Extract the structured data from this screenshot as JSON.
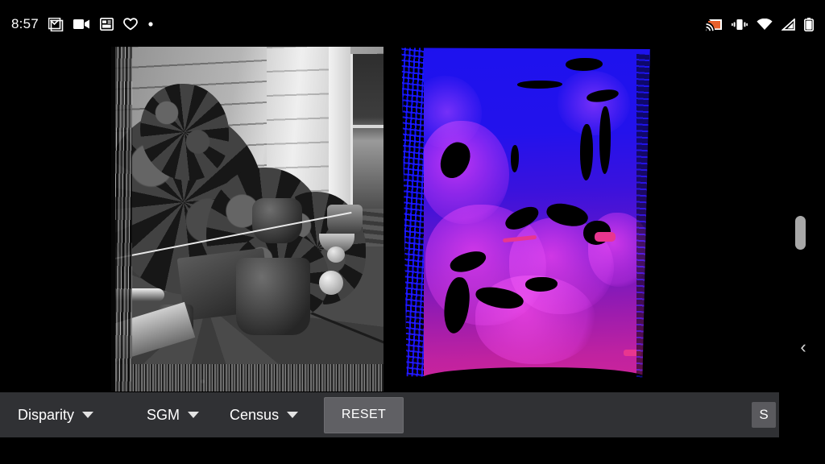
{
  "status_bar": {
    "time": "8:57",
    "left_icons": [
      {
        "name": "gmail-icon",
        "glyph": "M"
      },
      {
        "name": "video-camera-icon",
        "glyph": ""
      },
      {
        "name": "calendar-icon",
        "glyph": ""
      },
      {
        "name": "heart-icon",
        "glyph": ""
      },
      {
        "name": "more-dot-icon",
        "glyph": "•"
      }
    ],
    "right_icons": [
      {
        "name": "cast-icon",
        "color": "#e8602c"
      },
      {
        "name": "vibrate-icon",
        "color": "#ffffff"
      },
      {
        "name": "wifi-icon",
        "color": "#ffffff"
      },
      {
        "name": "cell-signal-icon",
        "color": "#ffffff"
      },
      {
        "name": "battery-icon",
        "color": "#ffffff"
      }
    ]
  },
  "viewer": {
    "left_image": {
      "name": "rectified-grayscale-image",
      "description": "Grayscale stereo reference photo of a backyard porch with potted plants"
    },
    "right_image": {
      "name": "disparity-map-image",
      "description": "Color-coded disparity map, blue = far, magenta = near",
      "near_color": "#cf2598",
      "far_color": "#1d12ee",
      "invalid_color": "#000000"
    }
  },
  "controls": {
    "view_mode": {
      "label": "Disparity",
      "caret": "dropdown-caret"
    },
    "algorithm": {
      "label": "SGM",
      "caret": "dropdown-caret"
    },
    "cost_metric": {
      "label": "Census",
      "caret": "dropdown-caret"
    },
    "reset_label": "RESET",
    "save_label": "S"
  },
  "navigation": {
    "back_chevron": "‹",
    "scrollbar": "vertical-scrollbar-thumb"
  },
  "colors": {
    "bar_background": "#303134",
    "button_fill": "#606064",
    "text": "#ffffff",
    "accent_cast": "#e8602c"
  }
}
